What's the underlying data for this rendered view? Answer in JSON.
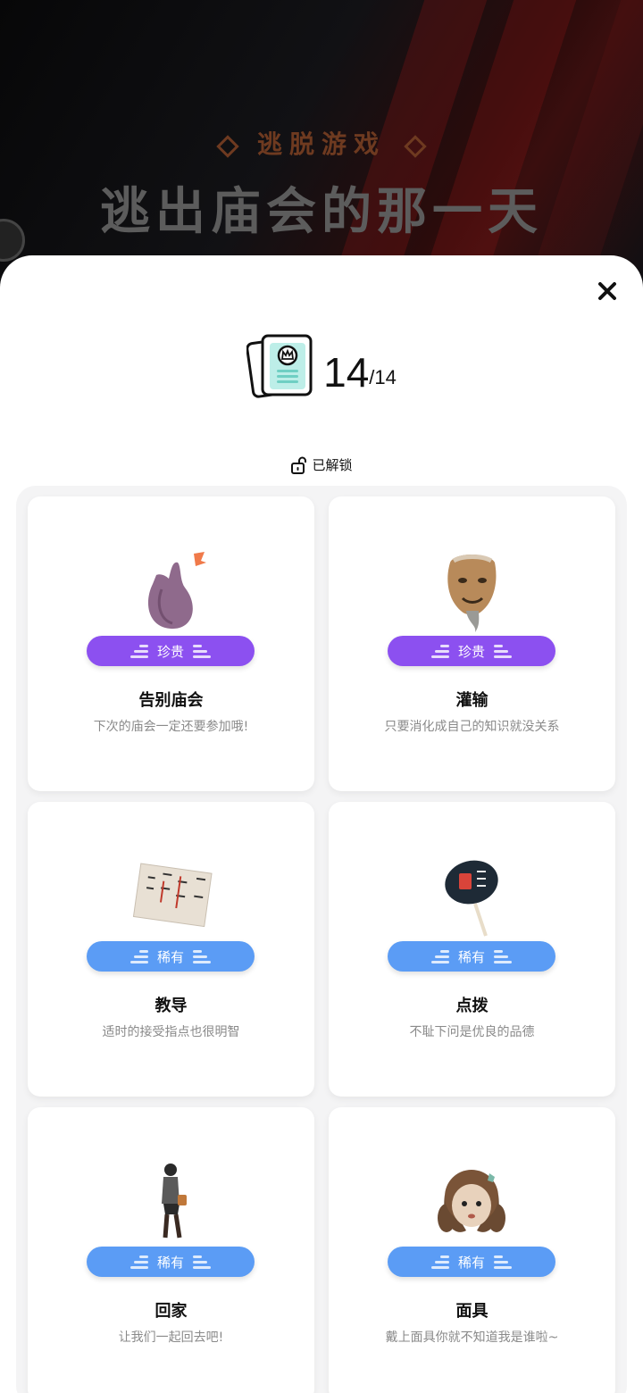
{
  "header": {
    "subtitle": "逃脱游戏",
    "title": "逃出庙会的那一天"
  },
  "counter": {
    "current": "14",
    "total": "/14"
  },
  "status_label": "已解锁",
  "colors": {
    "rare_purple": "#8c50f0",
    "rare_blue": "#5b9cf5",
    "close": "#111111"
  },
  "cards": [
    {
      "badge": "珍贵",
      "title": "告别庙会",
      "desc": "下次的庙会一定还要参加哦!",
      "icon": "purple-rabbit-mask-icon"
    },
    {
      "badge": "珍贵",
      "title": "灌输",
      "desc": "只要消化成自己的知识就没关系",
      "icon": "old-man-mask-icon"
    },
    {
      "badge": "稀有",
      "title": "教导",
      "desc": "适时的接受指点也很明智",
      "icon": "calligraphy-paper-icon"
    },
    {
      "badge": "稀有",
      "title": "点拨",
      "desc": "不耻下问是优良的品德",
      "icon": "paper-fan-icon"
    },
    {
      "badge": "稀有",
      "title": "回家",
      "desc": "让我们一起回去吧!",
      "icon": "walking-boy-icon"
    },
    {
      "badge": "稀有",
      "title": "面具",
      "desc": "戴上面具你就不知道我是谁啦~",
      "icon": "doll-mask-icon"
    }
  ]
}
